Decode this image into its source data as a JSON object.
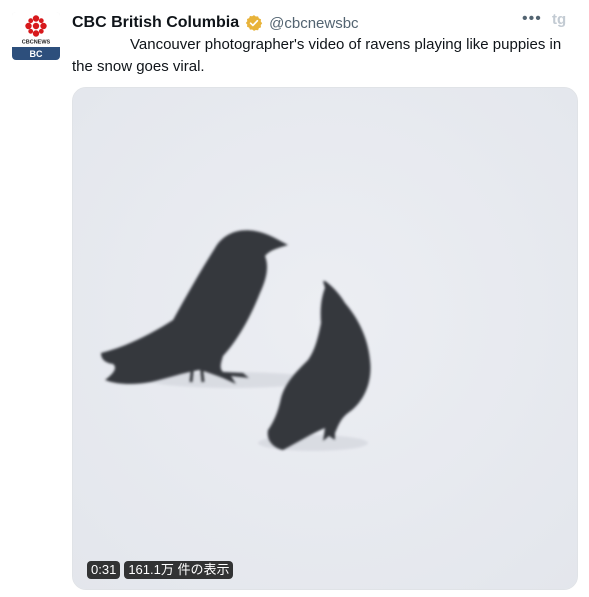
{
  "account": {
    "display_name": "CBC British Columbia",
    "handle": "@cbcnewsbc",
    "verified": true,
    "avatar": {
      "logo_text": "CBCNEWS",
      "region": "BC"
    }
  },
  "tweet": {
    "text": "Vancouver photographer's video of ravens playing like puppies in the snow goes viral."
  },
  "video": {
    "duration": "0:31",
    "views": "161.1万 件の表示"
  },
  "icons": {
    "more": "more-options-icon",
    "brand": "tweetdeck-brand-icon",
    "verified": "verified-badge-icon"
  },
  "colors": {
    "verified_gold": "#e8b33a",
    "cbc_red": "#d7191c",
    "text_secondary": "#536471",
    "snow_bg": "#e9ebf0"
  }
}
